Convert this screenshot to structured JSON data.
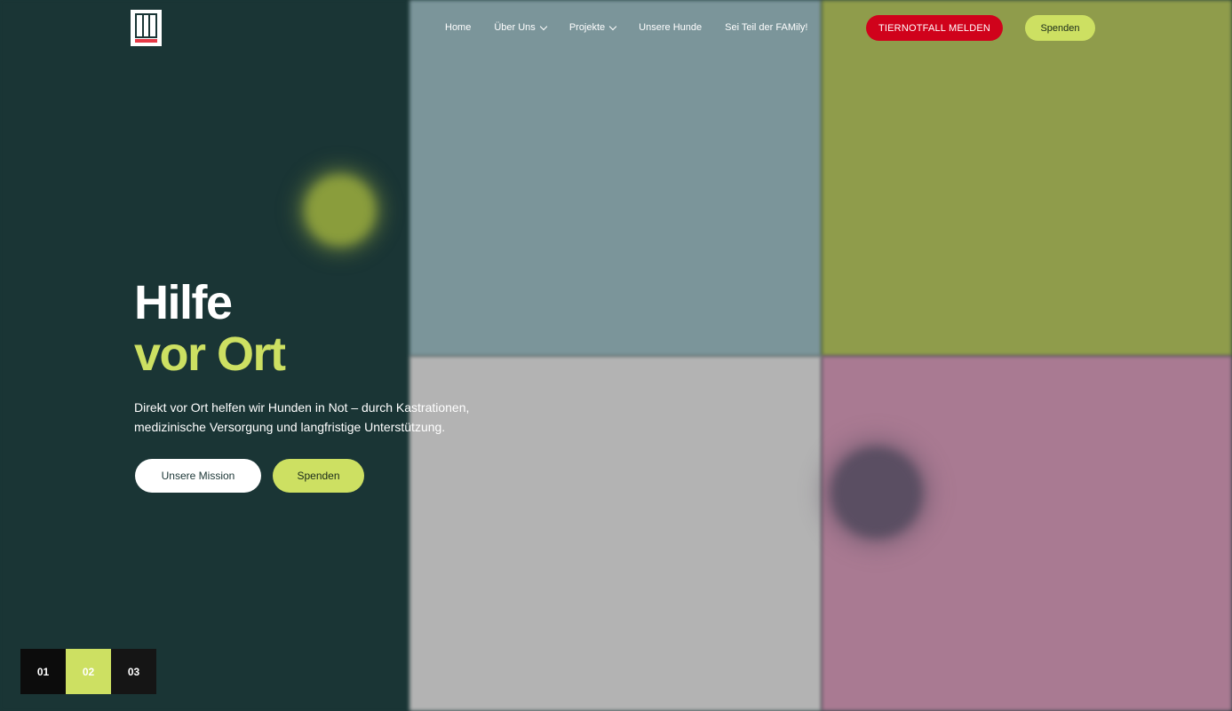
{
  "nav": {
    "items": [
      {
        "label": "Home",
        "has_dropdown": false
      },
      {
        "label": "Über Uns",
        "has_dropdown": true
      },
      {
        "label": "Projekte",
        "has_dropdown": true
      },
      {
        "label": "Unsere Hunde",
        "has_dropdown": false
      },
      {
        "label": "Sei Teil der FAMily!",
        "has_dropdown": false
      }
    ],
    "emergency_label": "TIERNOTFALL MELDEN",
    "donate_label": "Spenden"
  },
  "hero": {
    "title_line1": "Hilfe",
    "title_line2": "vor Ort",
    "description": "Direkt vor Ort helfen wir Hunden in Not – durch Kastrationen, medizinische Versorgung und langfristige Unterstützung.",
    "cta_primary": "Unsere Mission",
    "cta_secondary": "Spenden"
  },
  "slider": {
    "pages": [
      "01",
      "02",
      "03"
    ],
    "active_index": 1
  },
  "colors": {
    "brand_dark": "#1a3535",
    "accent_lime": "#cde062",
    "emergency_red": "#d0021b"
  }
}
